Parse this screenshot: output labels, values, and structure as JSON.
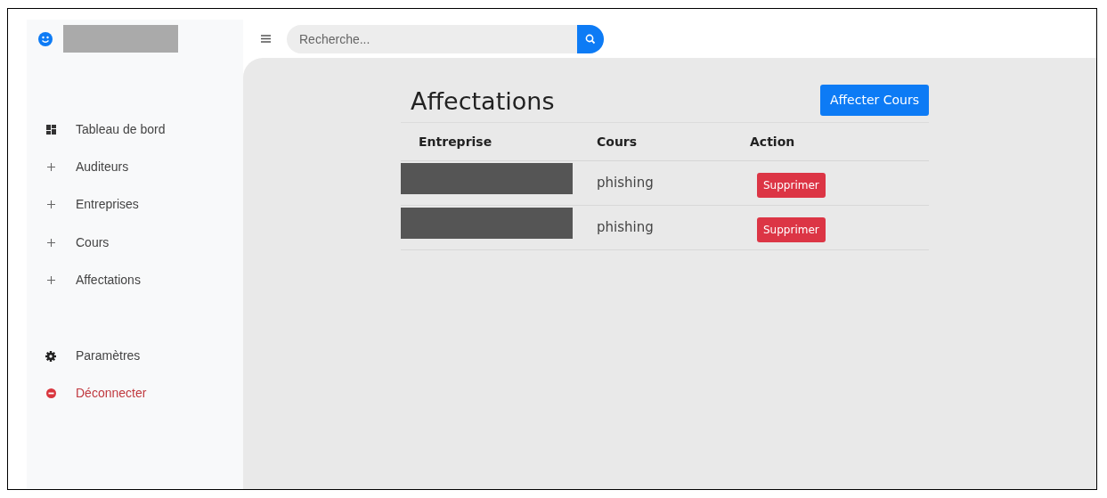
{
  "search": {
    "placeholder": "Recherche..."
  },
  "sidebar": {
    "items": [
      {
        "label": "Tableau de bord",
        "kind": "dashboard"
      },
      {
        "label": "Auditeurs",
        "kind": "plus"
      },
      {
        "label": "Entreprises",
        "kind": "plus"
      },
      {
        "label": "Cours",
        "kind": "plus"
      },
      {
        "label": "Affectations",
        "kind": "plus"
      }
    ],
    "bottom_items": [
      {
        "label": "Paramètres",
        "kind": "settings"
      },
      {
        "label": "Déconnecter",
        "kind": "logout"
      }
    ]
  },
  "page": {
    "title": "Affectations",
    "button": "Affecter Cours"
  },
  "table": {
    "columns": [
      "Entreprise",
      "Cours",
      "Action"
    ],
    "rows": [
      {
        "cours": "phishing",
        "action": "Supprimer"
      },
      {
        "cours": "phishing",
        "action": "Supprimer"
      }
    ]
  }
}
